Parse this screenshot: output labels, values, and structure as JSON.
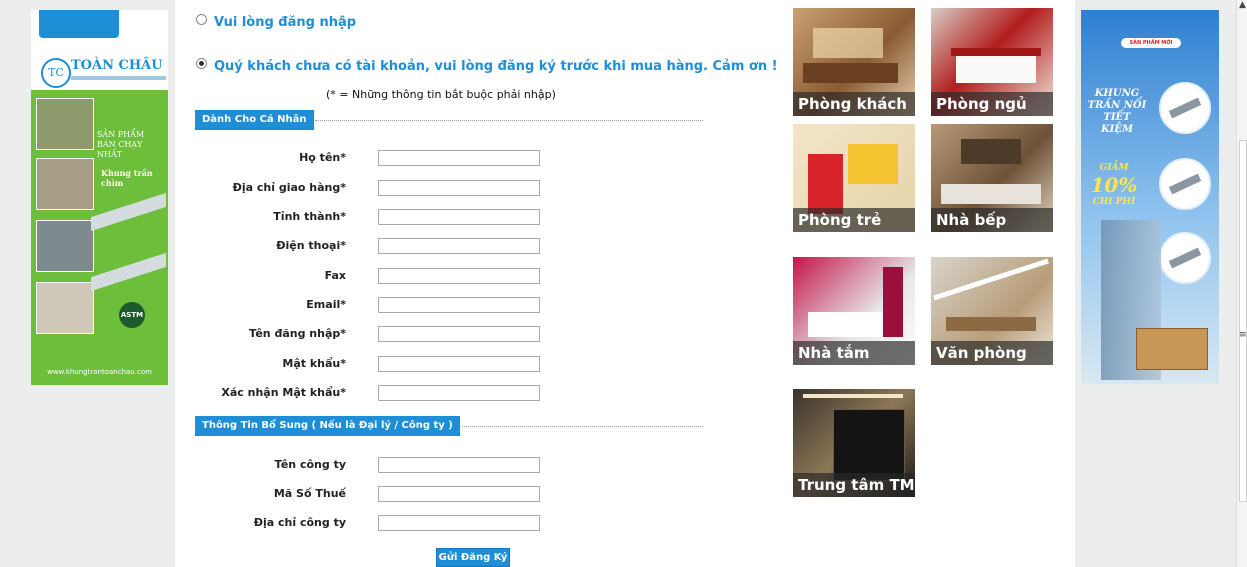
{
  "login_option": {
    "label": "Vui lòng đăng nhập"
  },
  "register_option": {
    "label": "Quý khách chưa có tài khoản, vui lòng đăng ký trước khi mua hàng. Cảm ơn !"
  },
  "required_note": "(* = Những thông tin bắt buộc phải nhập)",
  "personal_section": {
    "title": "Dành Cho Cá Nhân",
    "fields": [
      {
        "label": "Họ tên*",
        "value": ""
      },
      {
        "label": "Địa chỉ giao hàng*",
        "value": ""
      },
      {
        "label": "Tỉnh thành*",
        "value": ""
      },
      {
        "label": "Điện thoại*",
        "value": ""
      },
      {
        "label": "Fax",
        "value": ""
      },
      {
        "label": "Email*",
        "value": ""
      },
      {
        "label": "Tên đăng nhập*",
        "value": ""
      },
      {
        "label": "Mật khẩu*",
        "value": ""
      },
      {
        "label": "Xác nhận Mật khẩu*",
        "value": ""
      }
    ]
  },
  "company_section": {
    "title": "Thông Tin Bổ Sung ( Nếu là Đại lý / Công ty )",
    "fields": [
      {
        "label": "Tên công ty",
        "value": ""
      },
      {
        "label": "Mã Số Thuế",
        "value": ""
      },
      {
        "label": "Địa chỉ công ty",
        "value": ""
      }
    ]
  },
  "submit_label": "Gửi Đăng Ký",
  "rooms": [
    {
      "label": "Phòng khách"
    },
    {
      "label": "Phòng ngủ"
    },
    {
      "label": "Phòng trẻ"
    },
    {
      "label": "Nhà bếp"
    },
    {
      "label": "Nhà tắm"
    },
    {
      "label": "Văn phòng"
    },
    {
      "label": "Trung tâm TM"
    }
  ],
  "left_banner": {
    "brand": "TOÀN CHÂU",
    "logo_mark": "TC",
    "tagline": "SẢN PHẨM BÁN CHẠY NHẤT",
    "product": "Khung trần chìm",
    "badge": "ASTM",
    "website": "www.khungtrantoanchau.com"
  },
  "right_banner": {
    "tag": "SẢN PHẨM MỚI",
    "title": "KHUNG TRẦN NỔI TIẾT KIỆM",
    "save_prefix": "GIẢM",
    "save_percent": "10%",
    "save_suffix": "CHI PHÍ"
  },
  "colors": {
    "accent": "#1e8fd6",
    "page_bg": "#eceeed",
    "banner_green": "#6dbe3a"
  }
}
